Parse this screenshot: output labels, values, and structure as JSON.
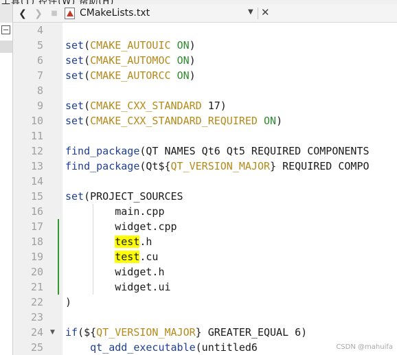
{
  "editor": {
    "file_title": "CMakeLists.txt",
    "icons": {
      "back": "arrow-left-icon",
      "forward": "arrow-right-icon",
      "lock": "lock-icon",
      "file": "cmake-file-icon",
      "dropdown": "chevron-down-icon",
      "close": "close-icon"
    }
  },
  "code_lines": [
    {
      "n": "4",
      "segments": []
    },
    {
      "n": "5",
      "segments": [
        {
          "t": "set",
          "c": "fn"
        },
        {
          "t": "(",
          "c": "plain"
        },
        {
          "t": "CMAKE_AUTOUIC",
          "c": "var"
        },
        {
          "t": " ",
          "c": "plain"
        },
        {
          "t": "ON",
          "c": "kw"
        },
        {
          "t": ")",
          "c": "plain"
        }
      ]
    },
    {
      "n": "6",
      "segments": [
        {
          "t": "set",
          "c": "fn"
        },
        {
          "t": "(",
          "c": "plain"
        },
        {
          "t": "CMAKE_AUTOMOC",
          "c": "var"
        },
        {
          "t": " ",
          "c": "plain"
        },
        {
          "t": "ON",
          "c": "kw"
        },
        {
          "t": ")",
          "c": "plain"
        }
      ]
    },
    {
      "n": "7",
      "segments": [
        {
          "t": "set",
          "c": "fn"
        },
        {
          "t": "(",
          "c": "plain"
        },
        {
          "t": "CMAKE_AUTORCC",
          "c": "var"
        },
        {
          "t": " ",
          "c": "plain"
        },
        {
          "t": "ON",
          "c": "kw"
        },
        {
          "t": ")",
          "c": "plain"
        }
      ]
    },
    {
      "n": "8",
      "segments": []
    },
    {
      "n": "9",
      "segments": [
        {
          "t": "set",
          "c": "fn"
        },
        {
          "t": "(",
          "c": "plain"
        },
        {
          "t": "CMAKE_CXX_STANDARD",
          "c": "var"
        },
        {
          "t": " 17)",
          "c": "plain"
        }
      ]
    },
    {
      "n": "10",
      "segments": [
        {
          "t": "set",
          "c": "fn"
        },
        {
          "t": "(",
          "c": "plain"
        },
        {
          "t": "CMAKE_CXX_STANDARD_REQUIRED",
          "c": "var"
        },
        {
          "t": " ",
          "c": "plain"
        },
        {
          "t": "ON",
          "c": "kw"
        },
        {
          "t": ")",
          "c": "plain"
        }
      ]
    },
    {
      "n": "11",
      "segments": []
    },
    {
      "n": "12",
      "segments": [
        {
          "t": "find_package",
          "c": "fn"
        },
        {
          "t": "(QT NAMES Qt6 Qt5 REQUIRED COMPONENTS",
          "c": "plain"
        }
      ]
    },
    {
      "n": "13",
      "segments": [
        {
          "t": "find_package",
          "c": "fn"
        },
        {
          "t": "(Qt${",
          "c": "plain"
        },
        {
          "t": "QT_VERSION_MAJOR",
          "c": "var"
        },
        {
          "t": "} REQUIRED COMPO",
          "c": "plain"
        }
      ]
    },
    {
      "n": "14",
      "segments": []
    },
    {
      "n": "15",
      "segments": [
        {
          "t": "set",
          "c": "fn"
        },
        {
          "t": "(PROJECT_SOURCES",
          "c": "plain"
        }
      ]
    },
    {
      "n": "16",
      "segments": [
        {
          "t": "        main.cpp",
          "c": "plain"
        }
      ]
    },
    {
      "n": "17",
      "segments": [
        {
          "t": "        widget.cpp",
          "c": "plain"
        }
      ]
    },
    {
      "n": "18",
      "segments": [
        {
          "t": "        ",
          "c": "plain"
        },
        {
          "t": "test",
          "c": "plain hl"
        },
        {
          "t": ".h",
          "c": "plain"
        }
      ]
    },
    {
      "n": "19",
      "segments": [
        {
          "t": "        ",
          "c": "plain"
        },
        {
          "t": "test",
          "c": "plain hl"
        },
        {
          "t": ".cu",
          "c": "plain"
        }
      ]
    },
    {
      "n": "20",
      "segments": [
        {
          "t": "        widget.h",
          "c": "plain"
        }
      ]
    },
    {
      "n": "21",
      "segments": [
        {
          "t": "        widget.ui",
          "c": "plain"
        }
      ]
    },
    {
      "n": "22",
      "segments": [
        {
          "t": ")",
          "c": "plain"
        }
      ]
    },
    {
      "n": "23",
      "segments": []
    },
    {
      "n": "24",
      "segments": [
        {
          "t": "if",
          "c": "fn"
        },
        {
          "t": "(${",
          "c": "plain"
        },
        {
          "t": "QT_VERSION_MAJOR",
          "c": "var"
        },
        {
          "t": "} GREATER_EQUAL 6)",
          "c": "plain"
        }
      ]
    },
    {
      "n": "25",
      "segments": [
        {
          "t": "    ",
          "c": "plain"
        },
        {
          "t": "qt_add_executable",
          "c": "fn"
        },
        {
          "t": "(untitled6",
          "c": "plain"
        }
      ]
    }
  ],
  "modified_lines": [
    "17",
    "18",
    "19",
    "20",
    "21"
  ],
  "folded_lines": [
    "24"
  ],
  "watermark": "CSDN @mahuifa"
}
